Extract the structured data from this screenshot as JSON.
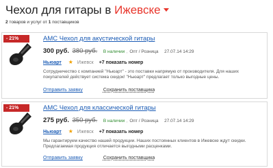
{
  "header": {
    "title_prefix": "Чехол для гитары в ",
    "city": "Ижевске"
  },
  "summary": {
    "count_goods": "2",
    "goods_text": " товаров и услуг от ",
    "count_suppliers": "1",
    "suppliers_text": " поставщиков"
  },
  "listings": [
    {
      "discount": "- 21%",
      "title": "AMC Чехол для акустической гитары",
      "price": "300 руб.",
      "old_price": "380 руб.",
      "stock": "В наличии",
      "trade": "Опт / Розница",
      "date": "27.07.14 14:29",
      "seller": "Ньюарт",
      "city": "Ижевск",
      "phone_prefix": "+7",
      "phone_link": "показать номер",
      "description": "Сотрудничество с компанией \"Ньюарт\" - это поставки напрямую от производителя. Для наших покупателей действует система скидок! \"Ньюарт\" предлагает только выгодные цены.",
      "send_label": "Отправить заявку",
      "save_label": "Сохранить поставщика"
    },
    {
      "discount": "- 21%",
      "title": "AMC Чехол для классической гитары",
      "price": "275 руб.",
      "old_price": "350 руб.",
      "stock": "В наличии",
      "trade": "Опт / Розница",
      "date": "27.07.14 14:29",
      "seller": "Ньюарт",
      "city": "Ижевск",
      "phone_prefix": "+7",
      "phone_link": "показать номер",
      "description": "Мы гарантируем качество нашей продукции. Наших постоянных клиентов в Ижевске ждут скидки. Предлагаемая продукция отличается выгодными расценками.",
      "send_label": "Отправить заявку",
      "save_label": "Сохранить поставщика"
    }
  ],
  "icons": {
    "guitar": "guitar-case-icon",
    "star": "star-icon",
    "caret": "chevron-down-icon"
  },
  "colors": {
    "accent": "#e8352b",
    "link": "#1a5bb5",
    "badge": "#c62828",
    "stock": "#2e8b2e"
  }
}
